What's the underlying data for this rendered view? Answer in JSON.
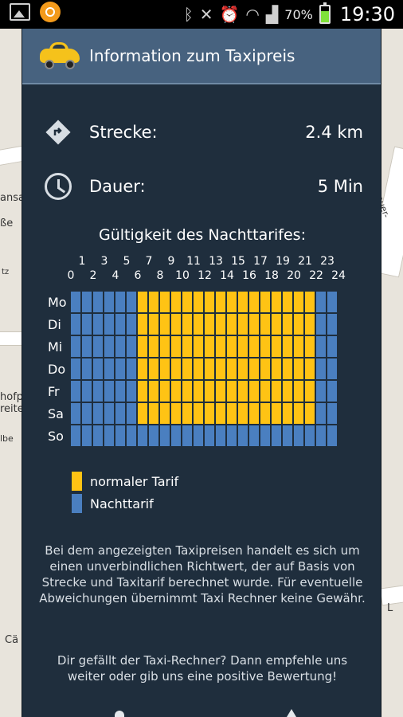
{
  "status_bar": {
    "battery_percent": "70%",
    "time": "19:30",
    "icons": [
      "gallery-icon",
      "app-orange-icon",
      "bluetooth-icon",
      "mute-icon",
      "alarm-icon",
      "wifi-icon",
      "signal-icon",
      "battery-icon"
    ]
  },
  "map": {
    "labels": [
      "ansa",
      "ße",
      "tz",
      "hofp",
      "reite",
      "lbe",
      "Cä",
      "auer-Ufer",
      "L"
    ]
  },
  "dialog": {
    "title": "Information zum Taxipreis",
    "route": {
      "label": "Strecke:",
      "value": "2.4 km"
    },
    "duration": {
      "label": "Dauer:",
      "value": "5 Min"
    },
    "section_title": "Gültigkeit des Nachttarifes:",
    "grid": {
      "hours_odd": [
        "1",
        "3",
        "5",
        "7",
        "9",
        "11",
        "13",
        "15",
        "17",
        "19",
        "21",
        "23"
      ],
      "hours_even": [
        "0",
        "2",
        "4",
        "6",
        "8",
        "10",
        "12",
        "14",
        "16",
        "18",
        "20",
        "22",
        "24"
      ],
      "days": [
        "Mo",
        "Di",
        "Mi",
        "Do",
        "Fr",
        "Sa",
        "So"
      ],
      "normal_tariff_hours_by_day": [
        [
          6,
          22
        ],
        [
          6,
          22
        ],
        [
          6,
          22
        ],
        [
          6,
          22
        ],
        [
          6,
          22
        ],
        [
          6,
          22
        ],
        []
      ],
      "colors": {
        "normal": "#ffc314",
        "night": "#4a7fc0"
      }
    },
    "legend": {
      "normal": "normaler Tarif",
      "night": "Nachttarif"
    },
    "disclaimer": "Bei dem angezeigten Taxipreisen handelt es sich um einen unverbindlichen Richtwert, der auf Basis von Strecke und Taxitarif berechnet wurde. Für eventuelle Abweichungen übernimmt Taxi Rechner keine Gewähr.",
    "recommend": "Dir gefällt der Taxi-Rechner? Dann empfehle uns weiter oder gib uns eine positive Bewertung!"
  }
}
